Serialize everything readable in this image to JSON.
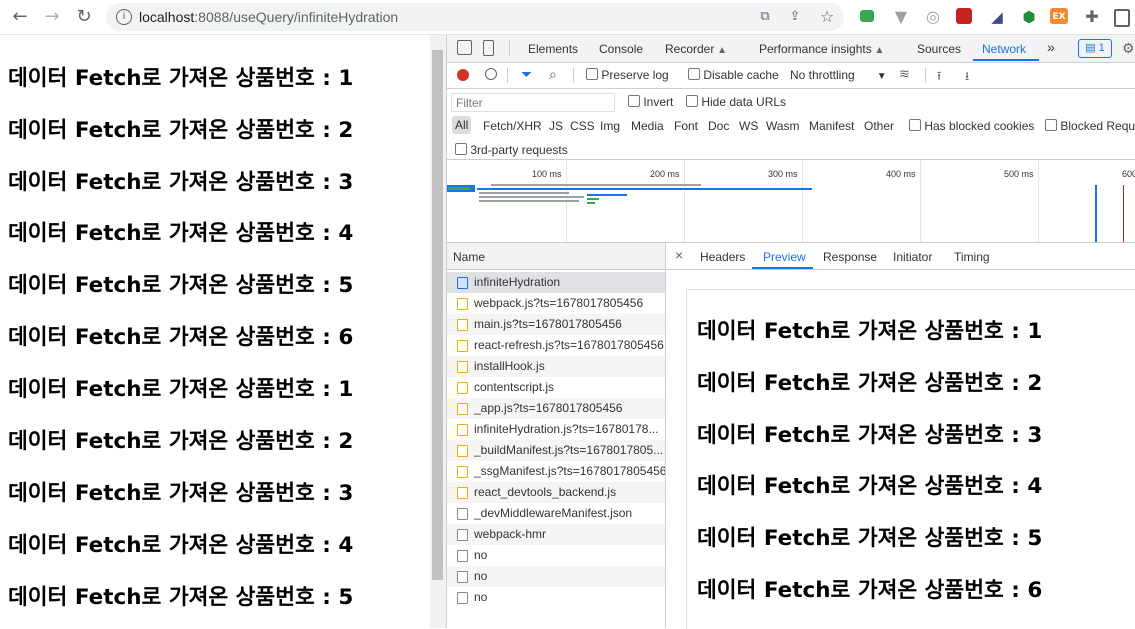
{
  "browser": {
    "url_host": "localhost",
    "url_rest": ":8088/useQuery/infiniteHydration",
    "icons": [
      "back-icon",
      "forward-icon",
      "reload-icon",
      "info-icon",
      "open-in-icon",
      "share-icon",
      "star-icon"
    ]
  },
  "page": {
    "items": [
      "데이터 Fetch로 가져온 상품번호 : 1",
      "데이터 Fetch로 가져온 상품번호 : 2",
      "데이터 Fetch로 가져온 상품번호 : 3",
      "데이터 Fetch로 가져온 상품번호 : 4",
      "데이터 Fetch로 가져온 상품번호 : 5",
      "데이터 Fetch로 가져온 상품번호 : 6",
      "데이터 Fetch로 가져온 상품번호 : 1",
      "데이터 Fetch로 가져온 상품번호 : 2",
      "데이터 Fetch로 가져온 상품번호 : 3",
      "데이터 Fetch로 가져온 상품번호 : 4",
      "데이터 Fetch로 가져온 상품번호 : 5"
    ]
  },
  "devtools": {
    "tabs": [
      "Elements",
      "Console",
      "Recorder",
      "Performance insights",
      "Sources",
      "Network"
    ],
    "more": "»",
    "issues_badge": "1",
    "toolbar": {
      "preserve_log": "Preserve log",
      "disable_cache": "Disable cache",
      "throttling": "No throttling"
    },
    "filter": {
      "placeholder": "Filter",
      "invert": "Invert",
      "hide_data_urls": "Hide data URLs",
      "types": [
        "All",
        "Fetch/XHR",
        "JS",
        "CSS",
        "Img",
        "Media",
        "Font",
        "Doc",
        "WS",
        "Wasm",
        "Manifest",
        "Other"
      ],
      "blocked_cookies": "Has blocked cookies",
      "blocked_requests": "Blocked Requ",
      "third_party": "3rd-party requests"
    },
    "timeline_ticks": [
      "100 ms",
      "200 ms",
      "300 ms",
      "400 ms",
      "500 ms",
      "600"
    ],
    "list_header": "Name",
    "requests": [
      {
        "name": "infiniteHydration",
        "kind": "doc"
      },
      {
        "name": "webpack.js?ts=1678017805456",
        "kind": "js"
      },
      {
        "name": "main.js?ts=1678017805456",
        "kind": "js"
      },
      {
        "name": "react-refresh.js?ts=1678017805456",
        "kind": "js"
      },
      {
        "name": "installHook.js",
        "kind": "js"
      },
      {
        "name": "contentscript.js",
        "kind": "js"
      },
      {
        "name": "_app.js?ts=1678017805456",
        "kind": "js"
      },
      {
        "name": "infiniteHydration.js?ts=16780178...",
        "kind": "js"
      },
      {
        "name": "_buildManifest.js?ts=1678017805...",
        "kind": "js"
      },
      {
        "name": "_ssgManifest.js?ts=1678017805456",
        "kind": "js"
      },
      {
        "name": "react_devtools_backend.js",
        "kind": "js"
      },
      {
        "name": "_devMiddlewareManifest.json",
        "kind": "other"
      },
      {
        "name": "webpack-hmr",
        "kind": "other"
      },
      {
        "name": "no",
        "kind": "other"
      },
      {
        "name": "no",
        "kind": "other"
      },
      {
        "name": "no",
        "kind": "other"
      }
    ],
    "detail_tabs": [
      "Headers",
      "Preview",
      "Response",
      "Initiator",
      "Timing"
    ],
    "close": "×",
    "preview_items": [
      "데이터 Fetch로 가져온 상품번호 : 1",
      "데이터 Fetch로 가져온 상품번호 : 2",
      "데이터 Fetch로 가져온 상품번호 : 3",
      "데이터 Fetch로 가져온 상품번호 : 4",
      "데이터 Fetch로 가져온 상품번호 : 5",
      "데이터 Fetch로 가져온 상품번호 : 6"
    ]
  },
  "colors": {
    "accent": "#1a73e8",
    "record": "#d93025"
  }
}
